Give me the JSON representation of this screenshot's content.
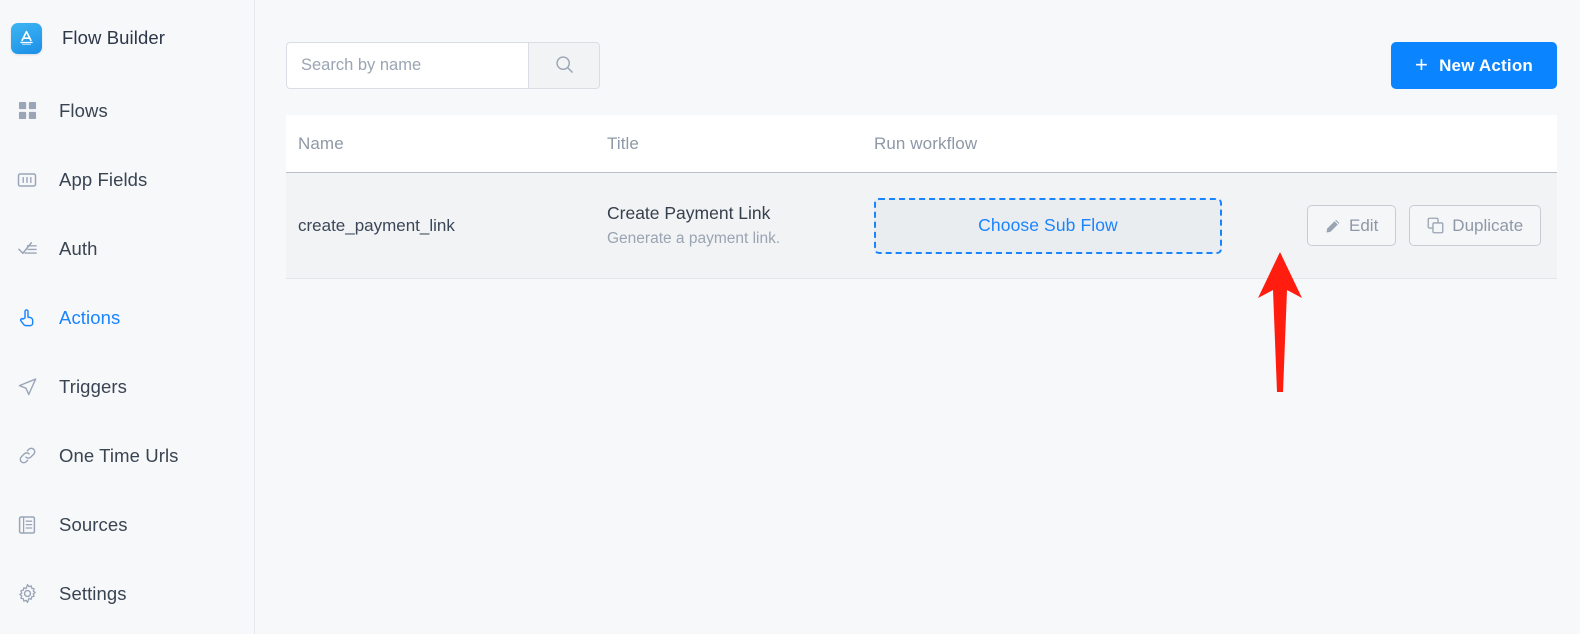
{
  "app": {
    "brand_name": "Flow Builder",
    "logo_icon": "app-store-logo-icon",
    "accent_color": "#0a84ff",
    "page_bg": "#f7f8fa"
  },
  "sidebar": {
    "items": [
      {
        "label": "Flows",
        "icon": "grid-icon",
        "active": false
      },
      {
        "label": "App Fields",
        "icon": "form-field-icon",
        "active": false
      },
      {
        "label": "Auth",
        "icon": "checklist-icon",
        "active": false
      },
      {
        "label": "Actions",
        "icon": "hand-click-icon",
        "active": true
      },
      {
        "label": "Triggers",
        "icon": "send-icon",
        "active": false
      },
      {
        "label": "One Time Urls",
        "icon": "link-icon",
        "active": false
      },
      {
        "label": "Sources",
        "icon": "book-icon",
        "active": false
      },
      {
        "label": "Settings",
        "icon": "gear-icon",
        "active": false
      }
    ]
  },
  "toolbar": {
    "search": {
      "value": "",
      "placeholder": "Search by name",
      "icon": "search-icon"
    },
    "new_action": {
      "label": "New Action",
      "icon": "plus-icon",
      "plus": "+"
    }
  },
  "table": {
    "columns": [
      "Name",
      "Title",
      "Run workflow"
    ],
    "rows": [
      {
        "name": "create_payment_link",
        "title": "Create Payment Link",
        "description": "Generate a payment link.",
        "run_workflow_label": "Choose Sub Flow",
        "actions": [
          {
            "label": "Edit",
            "icon": "pencil-icon"
          },
          {
            "label": "Duplicate",
            "icon": "copy-icon"
          }
        ]
      }
    ]
  },
  "annotation": {
    "type": "arrow",
    "color": "#ff1d0f",
    "points_at": "Choose Sub Flow"
  }
}
